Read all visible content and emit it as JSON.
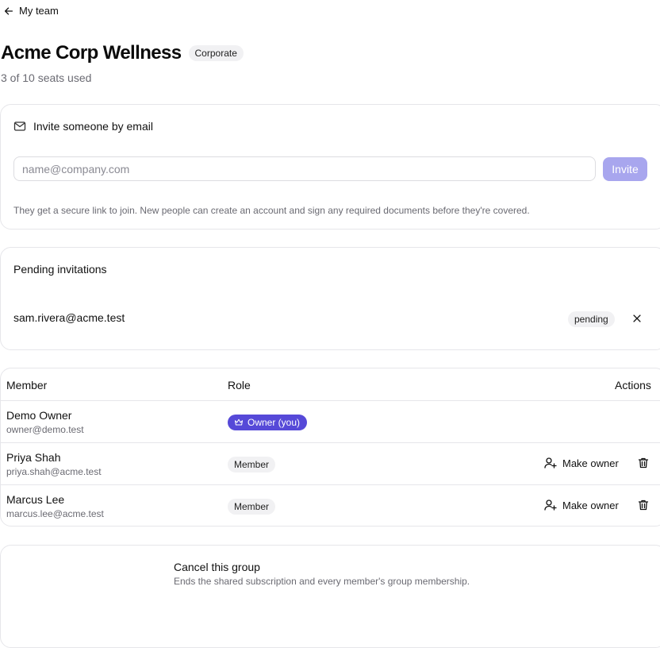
{
  "nav": {
    "back_label": "My team"
  },
  "group": {
    "name": "Acme Corp Wellness",
    "plan_badge": "Corporate",
    "seats_text": "3 of 10 seats used"
  },
  "invite": {
    "heading": "Invite someone by email",
    "placeholder": "name@company.com",
    "value": "",
    "button_label": "Invite",
    "help_text": "They get a secure link to join. New people can create an account and sign any required documents before they're covered."
  },
  "pending": {
    "heading": "Pending invitations",
    "items": [
      {
        "email": "sam.rivera@acme.test",
        "status": "pending"
      }
    ]
  },
  "members": {
    "headers": {
      "member": "Member",
      "role": "Role",
      "actions": "Actions"
    },
    "rows": [
      {
        "name": "Demo Owner",
        "email": "owner@demo.test",
        "role": "Owner (you)"
      },
      {
        "name": "Priya Shah",
        "email": "priya.shah@acme.test",
        "role": "Member",
        "action_label": "Make owner"
      },
      {
        "name": "Marcus Lee",
        "email": "marcus.lee@acme.test",
        "role": "Member",
        "action_label": "Make owner"
      }
    ]
  },
  "danger": {
    "title": "Cancel this group",
    "description": "Ends the shared subscription and every member's group membership."
  },
  "colors": {
    "accent": "#5649d8",
    "invite_button_disabled": "#a8a6ee",
    "muted_text": "#6a6a72",
    "border": "#e6e6ea"
  },
  "icons": {
    "back": "arrow-left-icon",
    "invite": "mail-icon",
    "remove": "close-icon",
    "owner": "crown-icon",
    "make_owner": "user-plus-icon",
    "delete": "trash-icon"
  }
}
